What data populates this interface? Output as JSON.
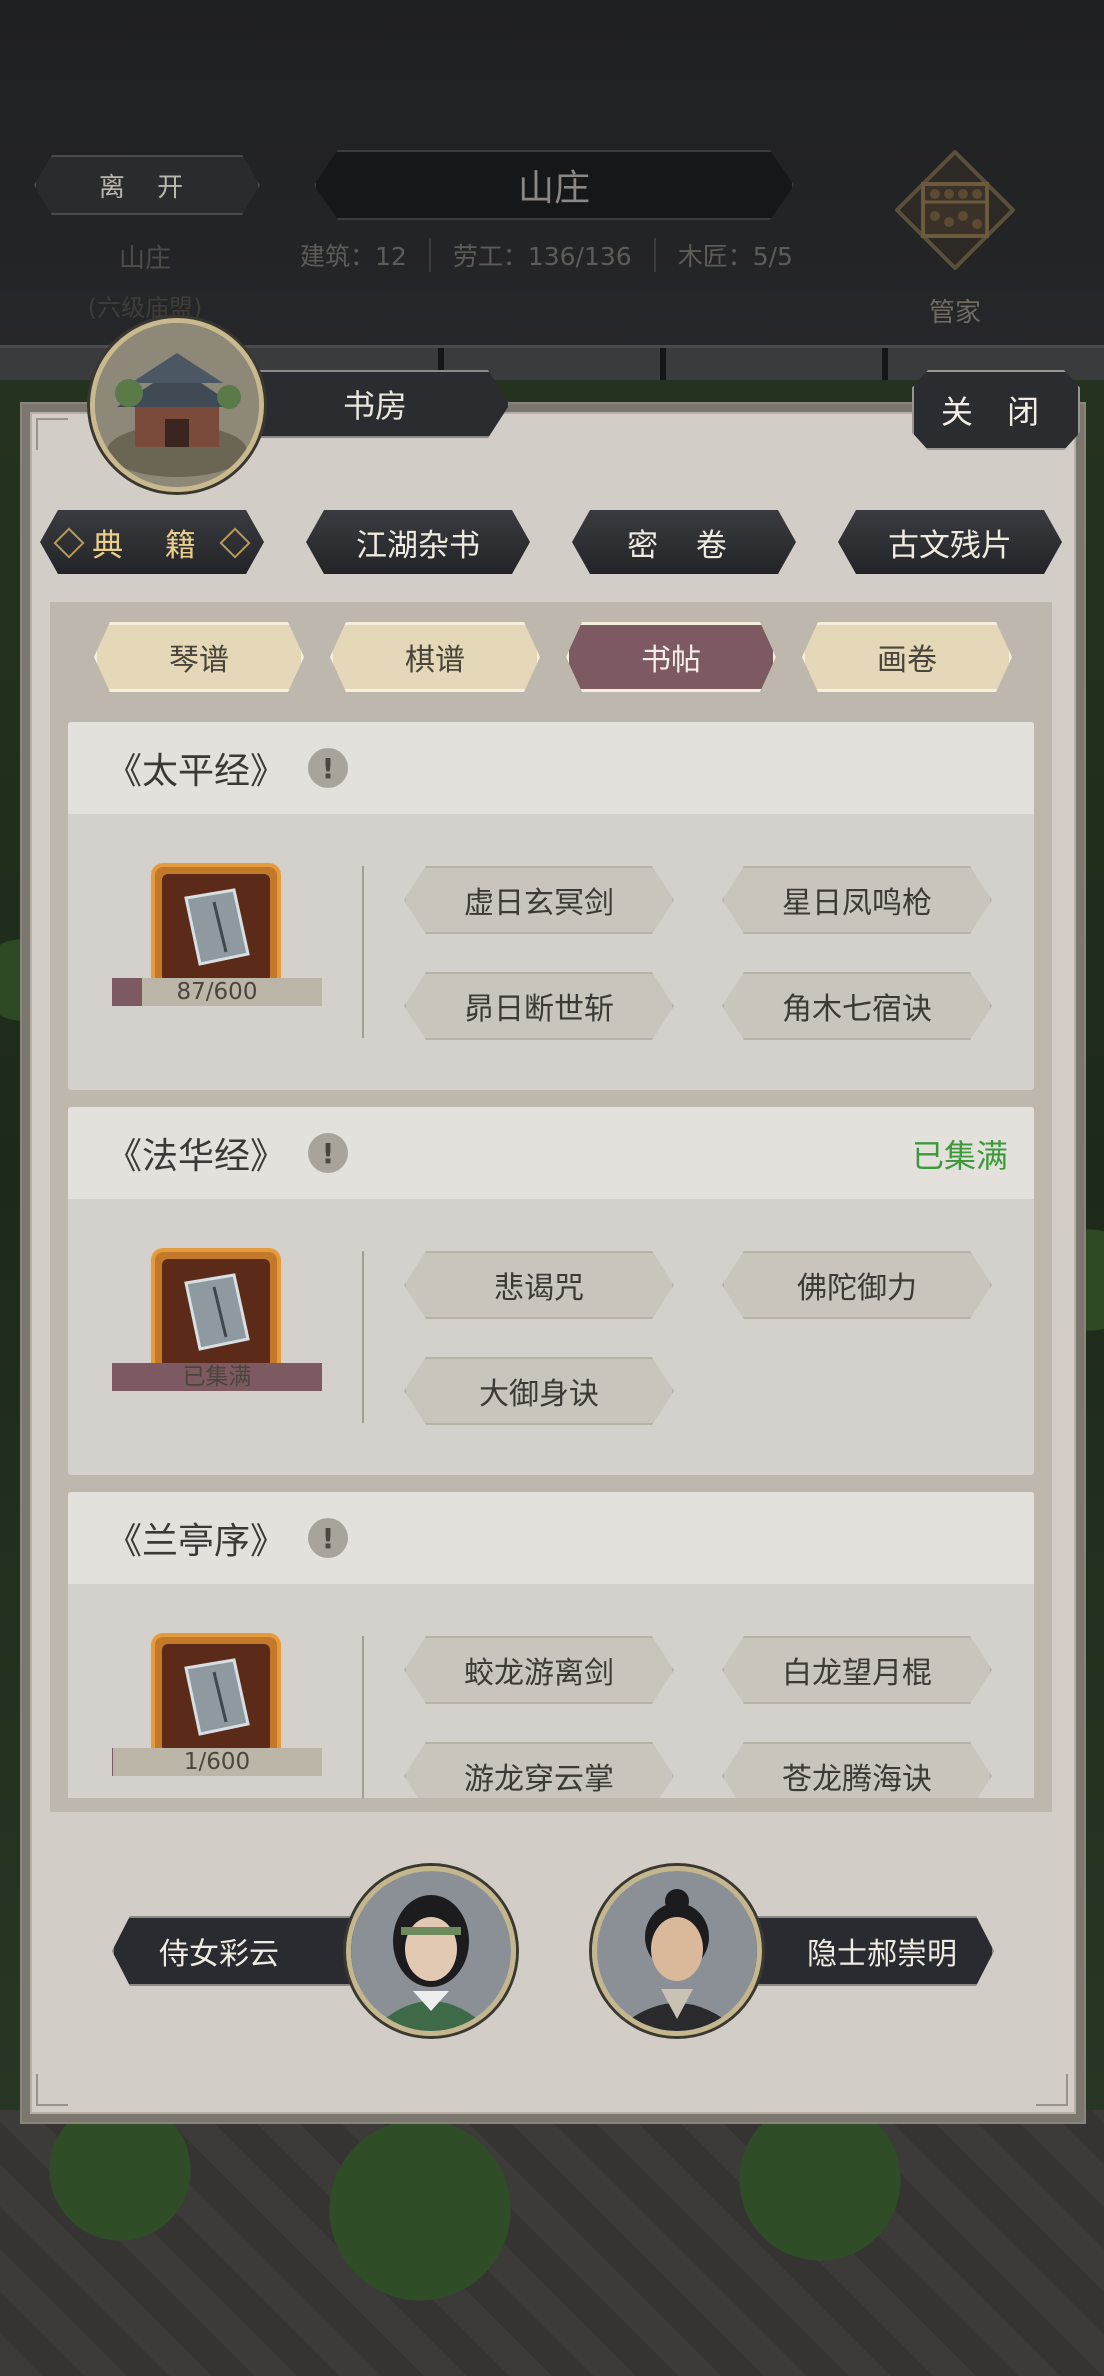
{
  "hud": {
    "leave_label": "离 开",
    "title": "山庄",
    "estate_name": "山庄",
    "estate_level": "(六级庙盟)",
    "stats": [
      {
        "label": "建筑：",
        "value": "12"
      },
      {
        "label": "劳工：",
        "value": "136/136"
      },
      {
        "label": "木匠：",
        "value": "5/5"
      }
    ],
    "steward_label": "管家"
  },
  "building": {
    "name": "书房",
    "close_label": "关 闭"
  },
  "main_tabs": [
    {
      "label": "典 籍",
      "active": true
    },
    {
      "label": "江湖杂书",
      "active": false
    },
    {
      "label": "密 卷",
      "active": false
    },
    {
      "label": "古文残片",
      "active": false
    }
  ],
  "sub_tabs": [
    {
      "label": "琴谱",
      "active": false
    },
    {
      "label": "棋谱",
      "active": false
    },
    {
      "label": "书帖",
      "active": true
    },
    {
      "label": "画卷",
      "active": false
    }
  ],
  "books": [
    {
      "title": "《太平经》",
      "alert": "!",
      "status": "",
      "progress_text": "87/600",
      "progress_fraction": 0.145,
      "skills": [
        "虚日玄冥剑",
        "星日凤鸣枪",
        "昴日断世斩",
        "角木七宿诀"
      ]
    },
    {
      "title": "《法华经》",
      "alert": "!",
      "status": "已集满",
      "progress_text": "已集满",
      "progress_fraction": 1.0,
      "skills": [
        "悲谒咒",
        "佛陀御力",
        "大御身诀"
      ]
    },
    {
      "title": "《兰亭序》",
      "alert": "!",
      "status": "",
      "progress_text": "1/600",
      "progress_fraction": 0.002,
      "skills": [
        "蛟龙游离剑",
        "白龙望月棍",
        "游龙穿云掌",
        "苍龙腾海诀"
      ]
    }
  ],
  "npcs": [
    {
      "name": "侍女彩云"
    },
    {
      "name": "隐士郝崇明"
    }
  ],
  "colors": {
    "active_subtab": "#7d5a62",
    "complete_status": "#3c9a3a",
    "gold_text": "#e9cf8a"
  }
}
